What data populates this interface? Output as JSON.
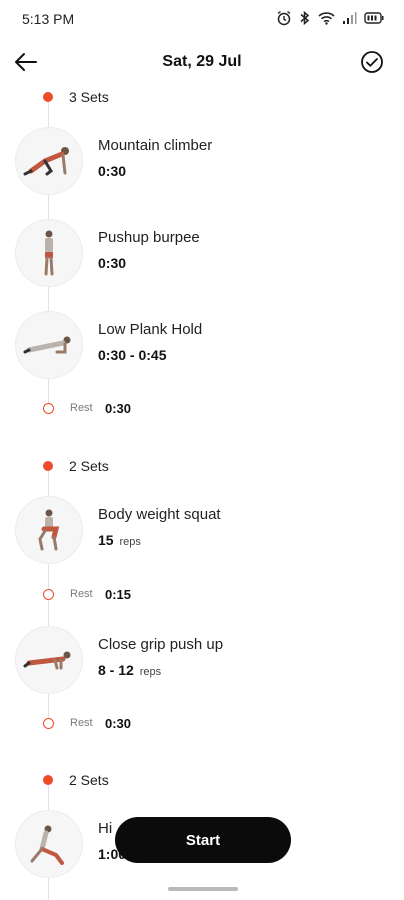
{
  "status_bar": {
    "time": "5:13 PM",
    "icons": [
      "alarm-icon",
      "bluetooth-icon",
      "wifi-icon",
      "signal-icon",
      "battery-icon"
    ]
  },
  "header": {
    "title": "Sat, 29 Jul",
    "back_icon": "arrow-left-icon",
    "done_icon": "check-circle-icon"
  },
  "timeline": {
    "accent_color": "#ee4b2b",
    "groups": [
      {
        "sets_label": "3 Sets",
        "exercises": [
          {
            "name": "Mountain climber",
            "value": "0:30",
            "unit": ""
          },
          {
            "name": "Pushup burpee",
            "value": "0:30",
            "unit": ""
          },
          {
            "name": "Low Plank Hold",
            "value": "0:30 - 0:45",
            "unit": ""
          }
        ],
        "rest_after": {
          "label": "Rest",
          "value": "0:30"
        }
      },
      {
        "sets_label": "2 Sets",
        "exercises": [
          {
            "name": "Body weight squat",
            "value": "15",
            "unit": "reps"
          }
        ],
        "rest_after_ex1": {
          "label": "Rest",
          "value": "0:15"
        },
        "exercises_2": [
          {
            "name": "Close grip push up",
            "value": "8 - 12",
            "unit": "reps"
          }
        ],
        "rest_after": {
          "label": "Rest",
          "value": "0:30"
        }
      },
      {
        "sets_label": "2 Sets",
        "exercises": [
          {
            "name": "Hi",
            "value": "1:00",
            "unit": ""
          }
        ]
      }
    ]
  },
  "start_button": {
    "label": "Start",
    "color": "#0b0b0b"
  }
}
